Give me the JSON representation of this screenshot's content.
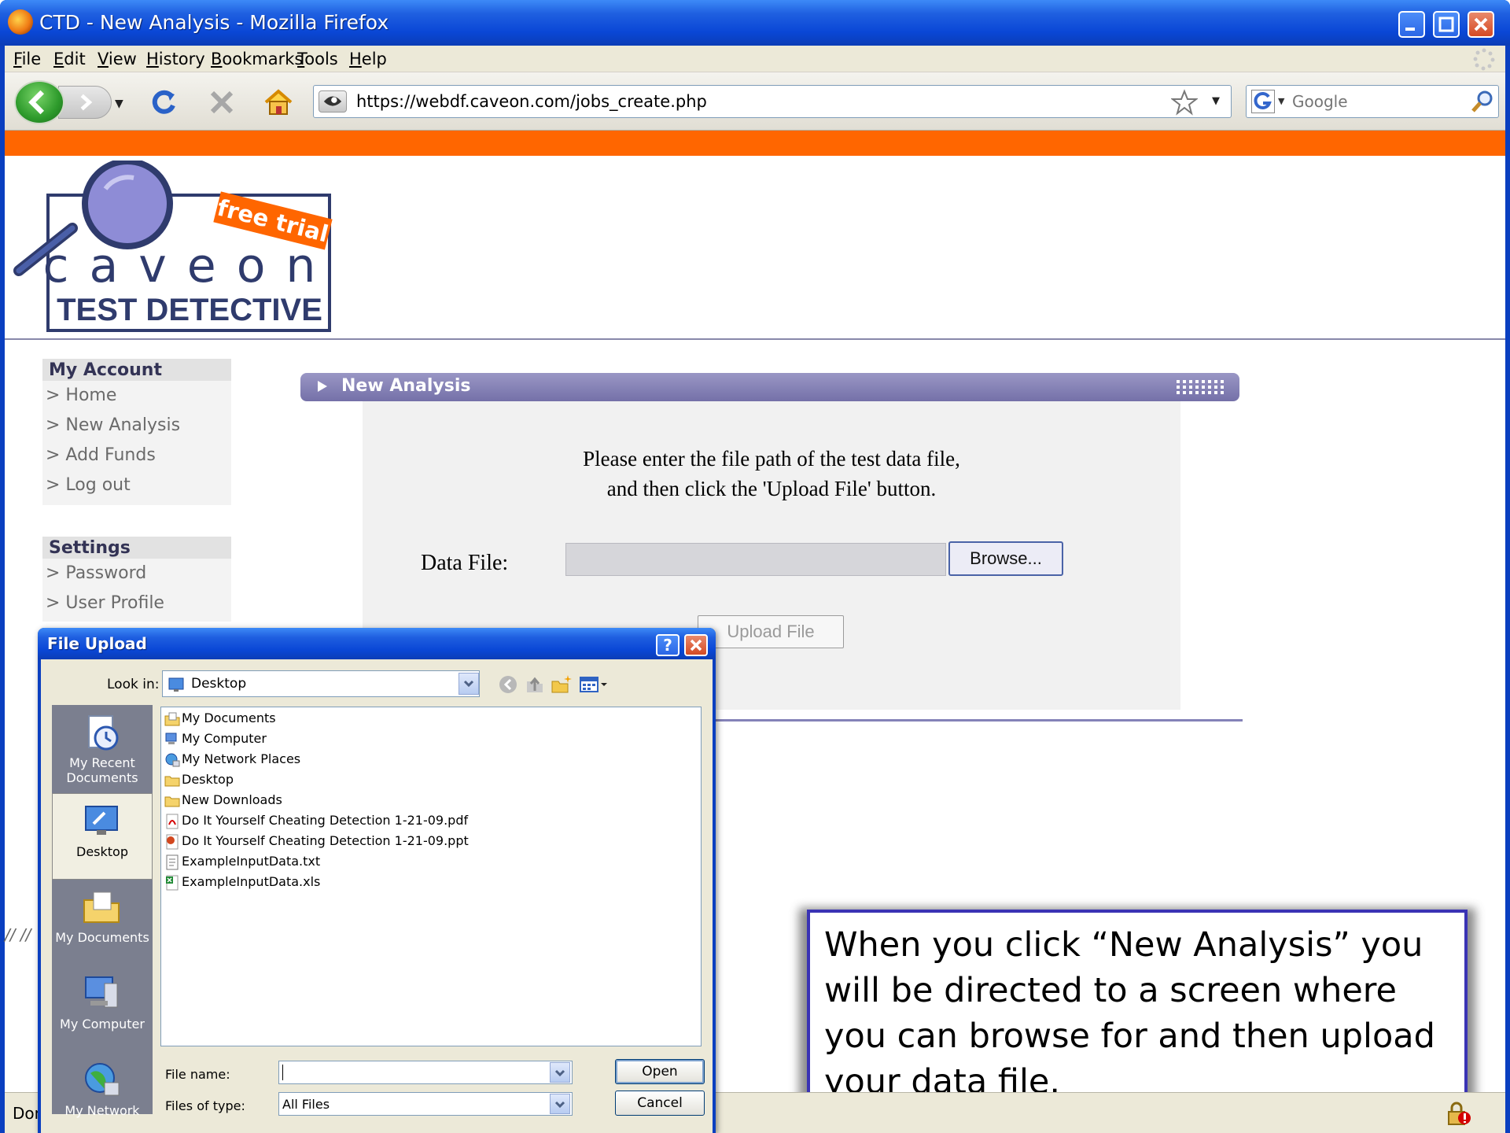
{
  "window": {
    "title": "CTD - New Analysis - Mozilla Firefox"
  },
  "menu": [
    "File",
    "Edit",
    "View",
    "History",
    "Bookmarks",
    "Tools",
    "Help"
  ],
  "navbar": {
    "url": "https://webdf.caveon.com/jobs_create.php",
    "search_placeholder": "Google"
  },
  "page": {
    "logo": {
      "badge": "free trial",
      "brand": "caveon",
      "product": "TEST DETECTIVE"
    },
    "sidebar": {
      "account_heading": "My Account",
      "account_links": [
        "> Home",
        "> New Analysis",
        "> Add Funds",
        "> Log out"
      ],
      "settings_heading": "Settings",
      "settings_links": [
        "> Password",
        "> User Profile"
      ]
    },
    "analysis": {
      "title": "New Analysis",
      "instructions_line1": "Please enter the file path of the test data file,",
      "instructions_line2": "and then click the 'Upload File' button.",
      "datafile_label": "Data File:",
      "browse_label": "Browse...",
      "upload_label": "Upload File"
    },
    "fragment_text": "// //"
  },
  "callout": {
    "text": "When you click “New Analysis” you will be directed to a screen where you can browse for and then upload your data file."
  },
  "statusbar": {
    "text": "Done"
  },
  "dialog": {
    "title": "File Upload",
    "help_label": "?",
    "lookin_label": "Look in:",
    "lookin_value": "Desktop",
    "places": [
      "My Recent Documents",
      "Desktop",
      "My Documents",
      "My Computer",
      "My Network"
    ],
    "files": [
      {
        "name": "My Documents",
        "icon": "my-documents-icon"
      },
      {
        "name": "My Computer",
        "icon": "my-computer-icon"
      },
      {
        "name": "My Network Places",
        "icon": "network-places-icon"
      },
      {
        "name": "Desktop",
        "icon": "folder-icon"
      },
      {
        "name": "New Downloads",
        "icon": "folder-icon"
      },
      {
        "name": "Do It Yourself Cheating Detection 1-21-09.pdf",
        "icon": "pdf-file-icon"
      },
      {
        "name": "Do It Yourself Cheating Detection 1-21-09.ppt",
        "icon": "ppt-file-icon"
      },
      {
        "name": "ExampleInputData.txt",
        "icon": "txt-file-icon"
      },
      {
        "name": "ExampleInputData.xls",
        "icon": "xls-file-icon"
      }
    ],
    "filename_label": "File name:",
    "filename_value": "",
    "filetype_label": "Files of type:",
    "filetype_value": "All Files",
    "open_label": "Open",
    "cancel_label": "Cancel"
  },
  "colors": {
    "orange_band": "#ff6600",
    "panel_purple": "#7f7cb0",
    "callout_border": "#3a33b4",
    "xp_blue": "#0a47d6"
  }
}
